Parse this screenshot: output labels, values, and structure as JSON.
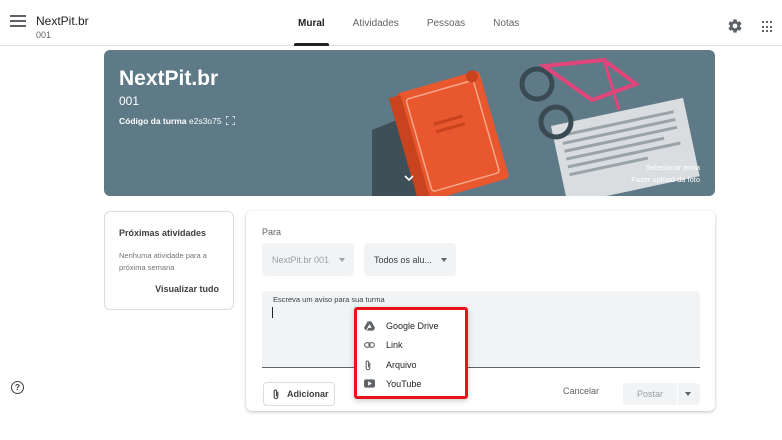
{
  "header": {
    "class_name": "NextPit.br",
    "class_section": "001",
    "tabs": [
      {
        "label": "Mural",
        "active": true
      },
      {
        "label": "Atividades",
        "active": false
      },
      {
        "label": "Pessoas",
        "active": false
      },
      {
        "label": "Notas",
        "active": false
      }
    ],
    "icons": [
      "menu-icon",
      "gear-icon",
      "apps-grid-icon"
    ]
  },
  "banner": {
    "title": "NextPit.br",
    "section": "001",
    "code_label": "Código da turma",
    "code_value": "e2s3o75",
    "select_theme": "Selecionar tema",
    "upload_photo": "Fazer upload da foto",
    "background_color": "#5f7a87"
  },
  "upcoming": {
    "title": "Próximas atividades",
    "empty_text": "Nenhuma atividade para a próxima semana",
    "view_all": "Visualizar tudo"
  },
  "composer": {
    "for_label": "Para",
    "class_select": "NextPit.br 001",
    "students_select": "Todos os alu...",
    "textarea_label": "Escreva um aviso para sua turma",
    "add_button": "Adicionar",
    "cancel_button": "Cancelar",
    "post_button": "Postar"
  },
  "attach_menu": {
    "highlight_color": "#e8121a",
    "items": [
      {
        "label": "Google Drive",
        "icon": "google-drive-icon"
      },
      {
        "label": "Link",
        "icon": "link-icon"
      },
      {
        "label": "Arquivo",
        "icon": "paperclip-icon"
      },
      {
        "label": "YouTube",
        "icon": "youtube-icon"
      }
    ]
  },
  "help": {
    "icon": "help-icon",
    "glyph": "?"
  }
}
